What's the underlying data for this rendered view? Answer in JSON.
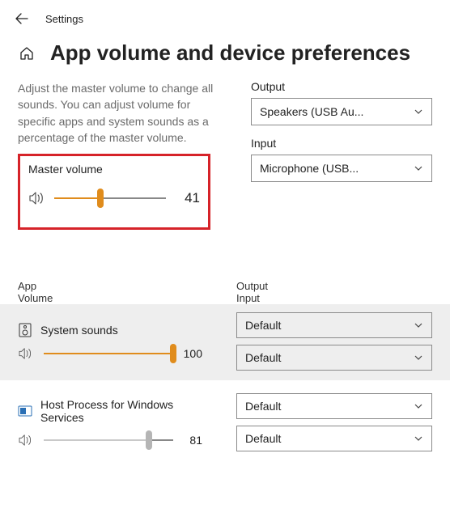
{
  "topbar": {
    "title": "Settings"
  },
  "header": {
    "page_title": "App volume and device preferences"
  },
  "description": "Adjust the master volume to change all sounds. You can adjust volume for specific apps and system sounds as a percentage of the master volume.",
  "device": {
    "output_label": "Output",
    "output_value": "Speakers (USB Au...",
    "input_label": "Input",
    "input_value": "Microphone (USB..."
  },
  "master": {
    "label": "Master volume",
    "value": "41",
    "percent": 41
  },
  "table": {
    "app_header": "App",
    "volume_header": "Volume",
    "output_header": "Output",
    "input_header": "Input"
  },
  "apps": [
    {
      "name": "System sounds",
      "volume": "100",
      "percent": 100,
      "output": "Default",
      "input": "Default",
      "highlighted": true,
      "color": "orange"
    },
    {
      "name": "Host Process for Windows Services",
      "volume": "81",
      "percent": 81,
      "output": "Default",
      "input": "Default",
      "highlighted": false,
      "color": "gray"
    }
  ]
}
